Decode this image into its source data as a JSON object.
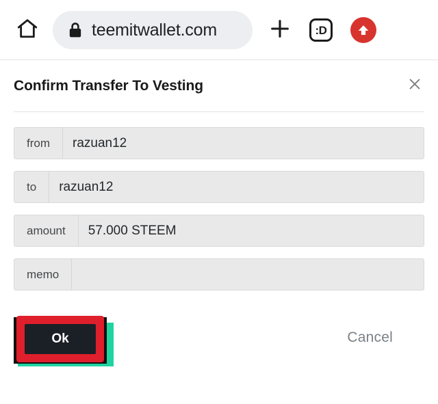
{
  "browser": {
    "home_icon": "home-icon",
    "lock_icon": "lock-icon",
    "url": "teemitwallet.com",
    "new_tab_icon": "plus-icon",
    "reader_icon": "smiley-face-icon",
    "reader_glyph": ":D",
    "upload_icon": "upload-arrow-icon"
  },
  "dialog": {
    "title": "Confirm Transfer To Vesting",
    "close_icon": "close-x-icon",
    "fields": [
      {
        "label": "from",
        "value": "razuan12"
      },
      {
        "label": "to",
        "value": "razuan12"
      },
      {
        "label": "amount",
        "value": "57.000 STEEM"
      },
      {
        "label": "memo",
        "value": ""
      }
    ],
    "ok_label": "Ok",
    "cancel_label": "Cancel"
  },
  "colors": {
    "highlight_red": "#e01f2c",
    "highlight_teal": "#1fd4a0",
    "highlight_black": "#111111",
    "button_dark": "#1b2026",
    "upload_red": "#d8342e",
    "field_bg": "#e9e9e9",
    "omnibox_bg": "#eceef1"
  }
}
